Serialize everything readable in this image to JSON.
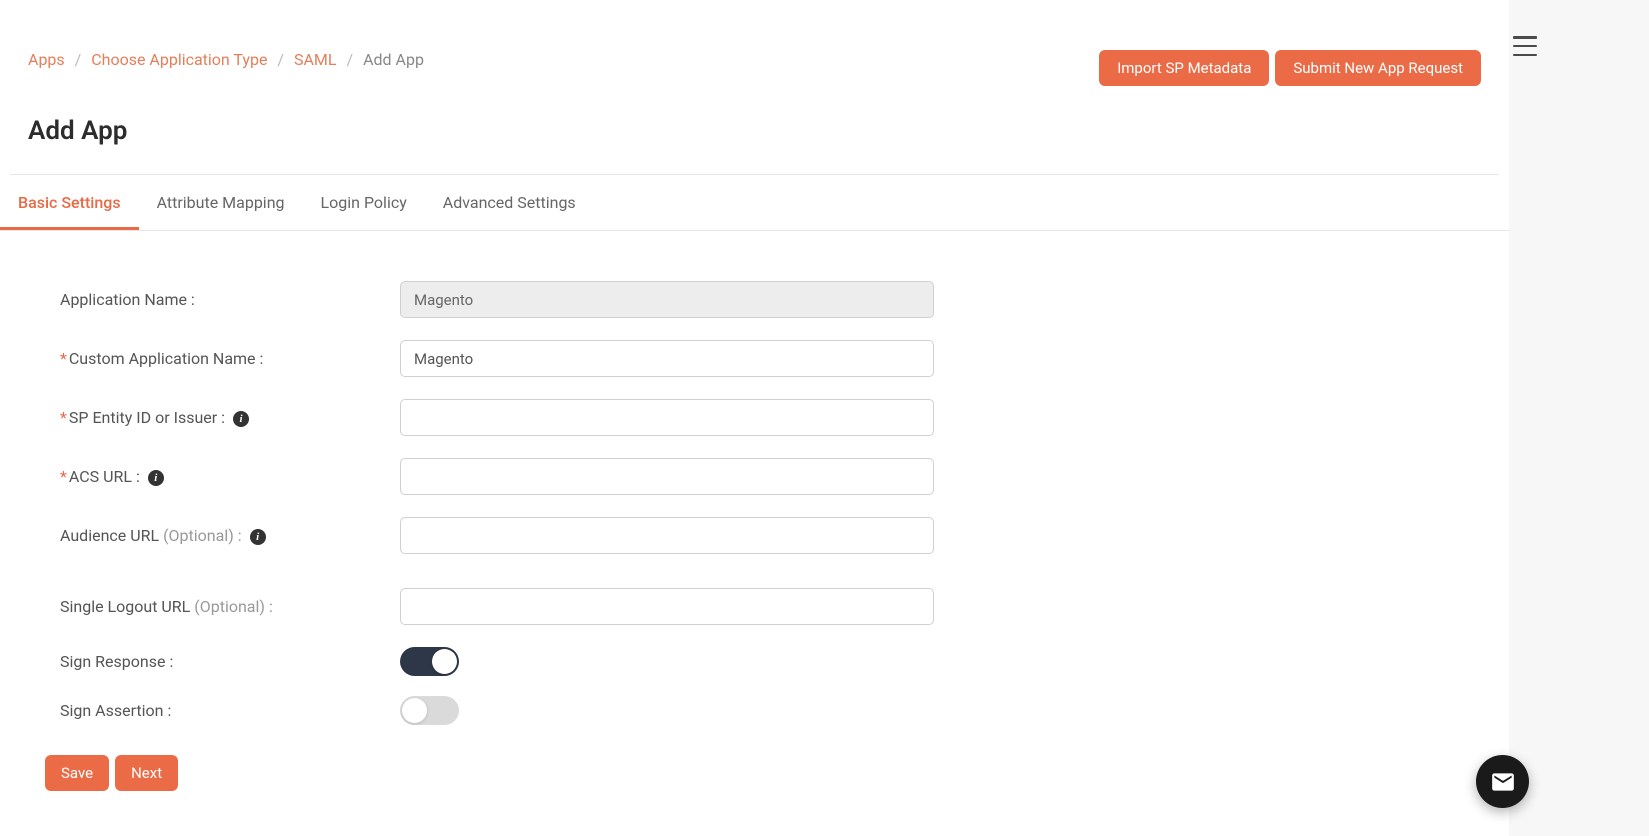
{
  "breadcrumb": {
    "items": [
      {
        "label": "Apps",
        "link": true
      },
      {
        "label": "Choose Application Type",
        "link": true
      },
      {
        "label": "SAML",
        "link": true
      },
      {
        "label": "Add App",
        "link": false
      }
    ]
  },
  "topButtons": {
    "import": "Import SP Metadata",
    "submit": "Submit New App Request"
  },
  "page": {
    "title": "Add App"
  },
  "tabs": {
    "basic": "Basic Settings",
    "attribute": "Attribute Mapping",
    "login": "Login Policy",
    "advanced": "Advanced Settings"
  },
  "form": {
    "appName": {
      "label": "Application Name :",
      "value": "Magento"
    },
    "customName": {
      "label": "Custom Application Name :",
      "value": "Magento"
    },
    "spEntity": {
      "label": "SP Entity ID or Issuer :",
      "value": ""
    },
    "acsUrl": {
      "label": "ACS URL :",
      "value": ""
    },
    "audienceUrl": {
      "label": "Audience URL",
      "optional": "(Optional) :",
      "value": ""
    },
    "sloUrl": {
      "label": "Single Logout URL",
      "optional": "(Optional) :",
      "value": ""
    },
    "signResponse": {
      "label": "Sign Response :",
      "value": true
    },
    "signAssertion": {
      "label": "Sign Assertion :",
      "value": false
    }
  },
  "bottomButtons": {
    "save": "Save",
    "next": "Next"
  },
  "infoGlyph": "i"
}
